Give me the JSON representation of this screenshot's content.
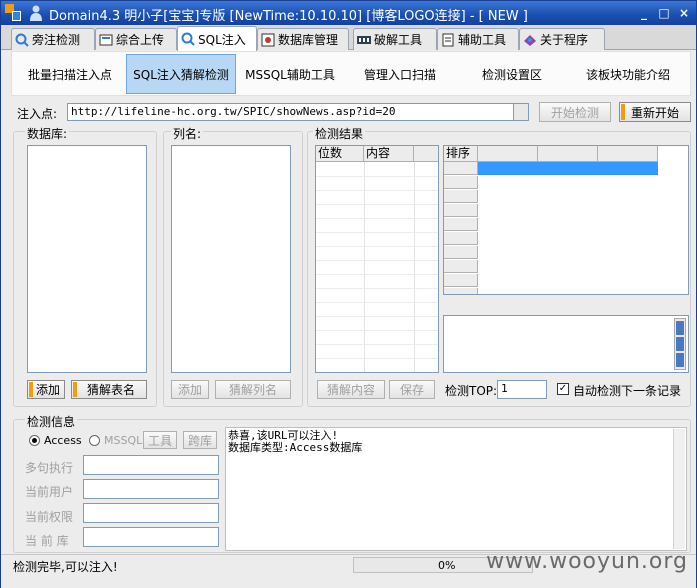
{
  "window": {
    "title": "Domain4.3 明小子[宝宝]专版 [NewTime:10.10.10] [博客LOGO连接]  - [ NEW ]",
    "controls": [
      "_",
      "□",
      "×"
    ]
  },
  "tabs": [
    {
      "label": "旁注检测",
      "icon": "magnifier-icon"
    },
    {
      "label": "综合上传",
      "icon": "upload-icon"
    },
    {
      "label": "SQL注入",
      "icon": "sql-injection-icon",
      "active": true
    },
    {
      "label": "数据库管理",
      "icon": "database-icon"
    },
    {
      "label": "破解工具",
      "icon": "crack-icon"
    },
    {
      "label": "辅助工具",
      "icon": "tools-icon"
    },
    {
      "label": "关于程序",
      "icon": "about-icon"
    }
  ],
  "subtabs": [
    {
      "label": "批量扫描注入点"
    },
    {
      "label": "SQL注入猜解检测",
      "active": true
    },
    {
      "label": "MSSQL辅助工具"
    },
    {
      "label": "管理入口扫描"
    },
    {
      "label": "检测设置区"
    },
    {
      "label": "该板块功能介绍"
    }
  ],
  "inject": {
    "label": "注入点:",
    "url": "http://lifeline-hc.org.tw/SPIC/showNews.asp?id=20",
    "start_button": "开始检测",
    "restart_button": "重新开始"
  },
  "database_panel": {
    "label": "数据库:",
    "add_button": "添加",
    "guess_tables_button": "猜解表名"
  },
  "column_panel": {
    "label": "列名:",
    "add_button": "添加",
    "guess_columns_button": "猜解列名"
  },
  "results_panel": {
    "label": "检测结果",
    "col_position": "位数",
    "col_content": "内容",
    "rank_header": "排序",
    "guess_content_button": "猜解内容",
    "save_button": "保存",
    "top_label": "检测TOP:",
    "top_value": "1",
    "auto_label": "自动检测下一条记录",
    "auto_checked": true
  },
  "info_panel": {
    "label": "检测信息",
    "radio_access": "Access",
    "radio_mssql": "MSSQL",
    "tools_button": "工具",
    "cross_db_button": "跨库",
    "field_multi_exec": "多句执行",
    "field_current_user": "当前用户",
    "field_current_perm": "当前权限",
    "field_current_db": "当 前 库",
    "log_line1": "恭喜,该URL可以注入!",
    "log_line2": "数据库类型:Access数据库"
  },
  "status": {
    "message": "检测完毕,可以注入!",
    "progress_text": "0%",
    "progress": 0
  },
  "watermark": "www.wooyun.org",
  "colors": {
    "title_bar": "#1a4fae",
    "selection": "#3399ff",
    "accent": "#f39c12"
  }
}
